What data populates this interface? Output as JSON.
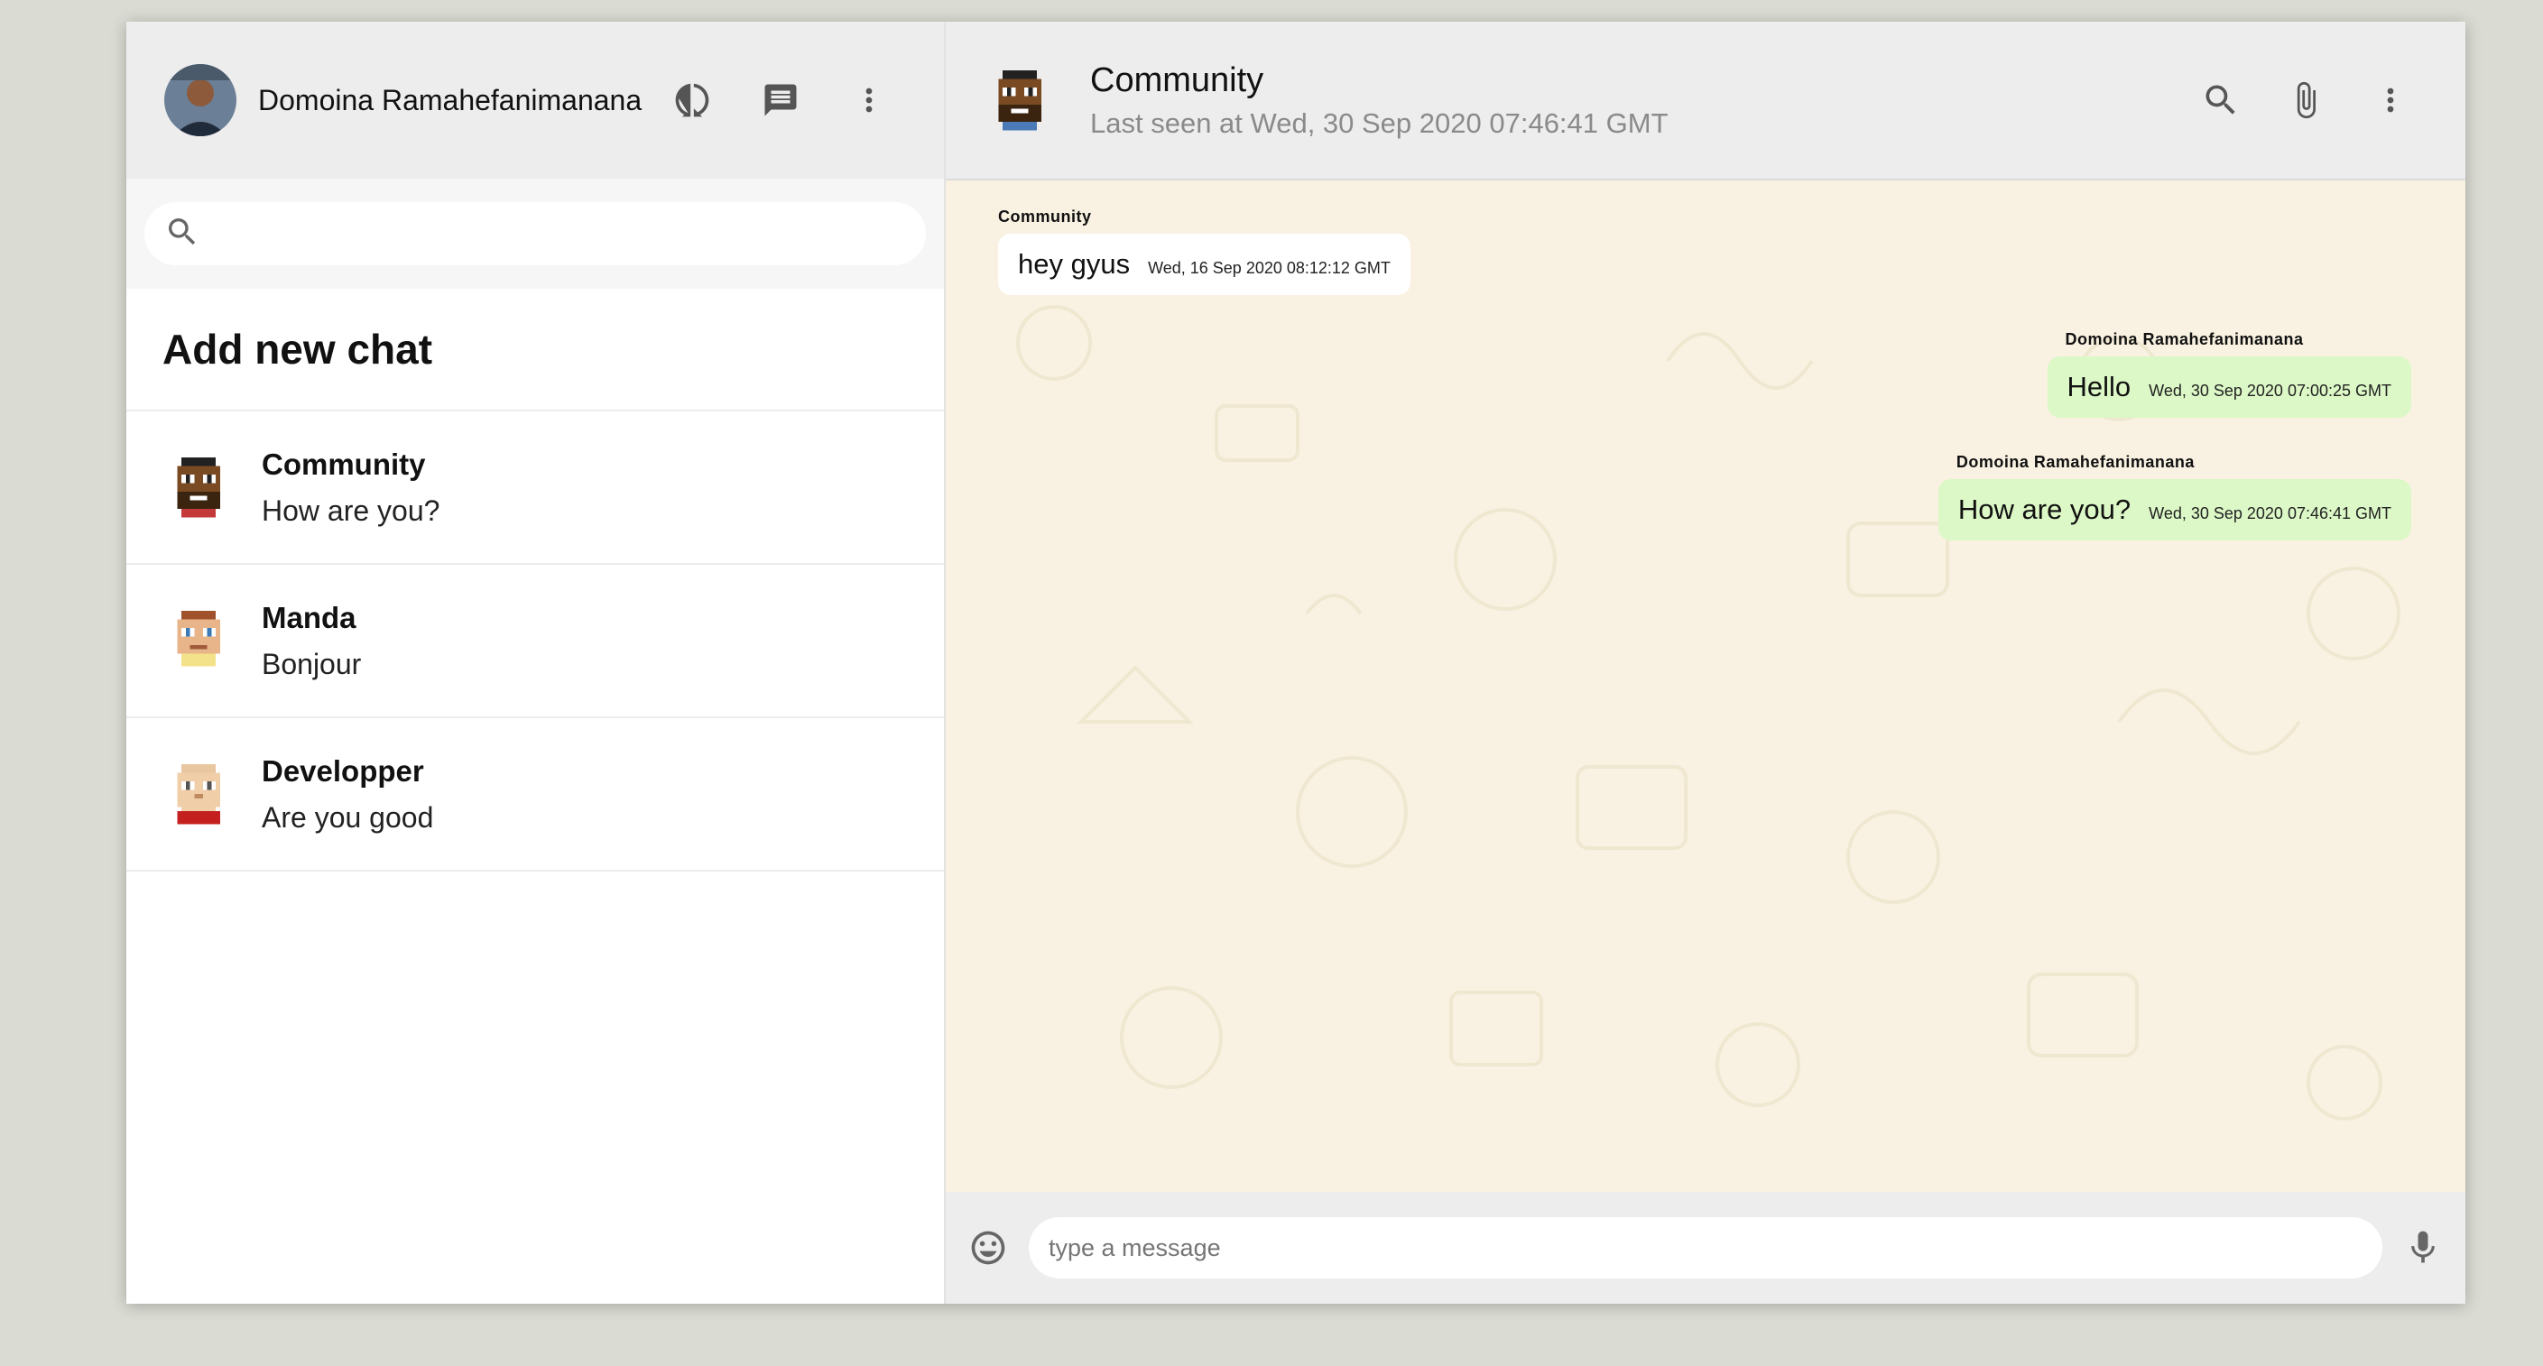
{
  "user": {
    "name": "Domoina Ramahefanimanana"
  },
  "search": {
    "placeholder": ""
  },
  "sidebar": {
    "add_chat_label": "Add new chat",
    "chats": [
      {
        "name": "Community",
        "last_message": "How are you?"
      },
      {
        "name": "Manda",
        "last_message": "Bonjour"
      },
      {
        "name": "Developper",
        "last_message": "Are you good"
      }
    ]
  },
  "chat": {
    "title": "Community",
    "subtitle": "Last seen at Wed, 30 Sep 2020 07:46:41 GMT",
    "messages": [
      {
        "author": "Community",
        "text": "hey gyus",
        "time": "Wed, 16 Sep 2020 08:12:12 GMT",
        "direction": "incoming"
      },
      {
        "author": "Domoina Ramahefanimanana",
        "text": "Hello",
        "time": "Wed, 30 Sep 2020 07:00:25 GMT",
        "direction": "outgoing"
      },
      {
        "author": "Domoina Ramahefanimanana",
        "text": "How are you?",
        "time": "Wed, 30 Sep 2020 07:46:41 GMT",
        "direction": "outgoing"
      }
    ]
  },
  "composer": {
    "placeholder": "type a message"
  },
  "icons": {
    "header": [
      "status-icon",
      "new-chat-icon",
      "more-vert-icon"
    ],
    "chat_header": [
      "search-icon",
      "attach-icon",
      "more-vert-icon"
    ],
    "composer": [
      "emoji-icon",
      "mic-icon"
    ]
  },
  "colors": {
    "header_bg": "#ededed",
    "chat_bg": "#f9f2e2",
    "incoming_bubble": "#ffffff",
    "outgoing_bubble": "#dcf8c6"
  }
}
